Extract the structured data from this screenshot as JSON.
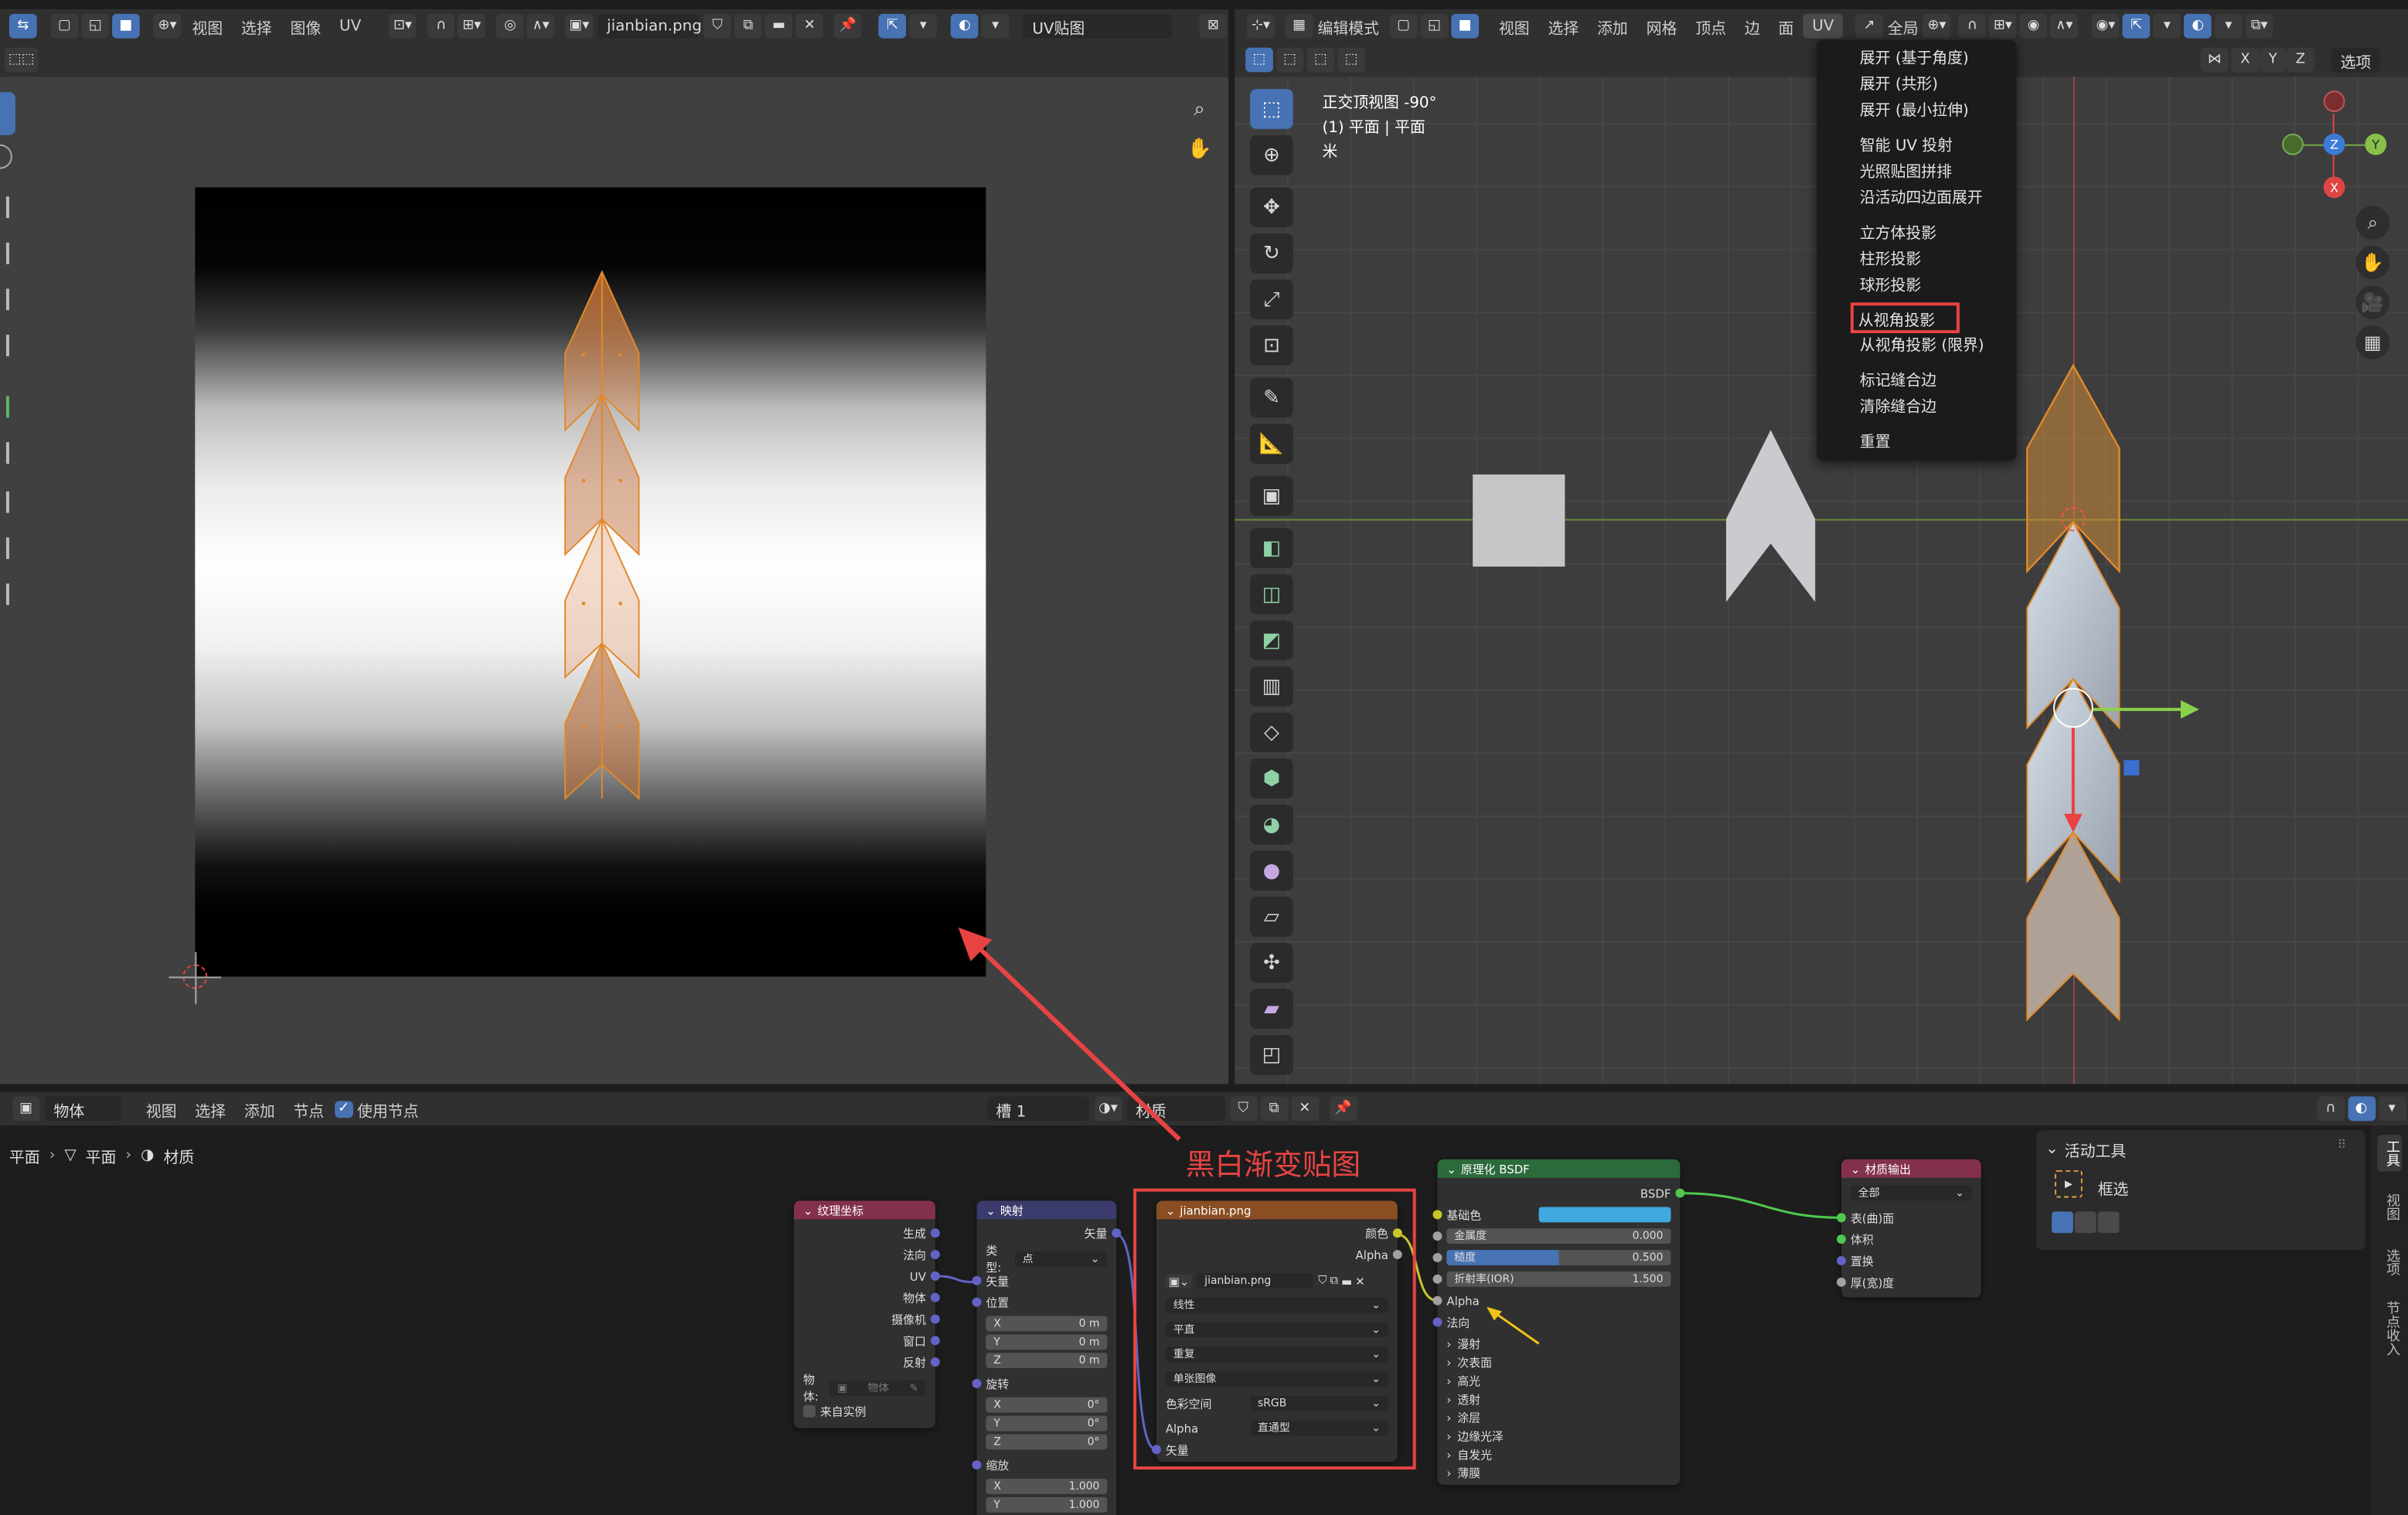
{
  "uv_editor": {
    "header": {
      "menus": [
        "视图",
        "选择",
        "图像",
        "UV"
      ],
      "image_name": "jianbian.png",
      "uv_map": "UV贴图"
    }
  },
  "viewport3d": {
    "header": {
      "mode": "编辑模式",
      "menus": [
        "视图",
        "选择",
        "添加",
        "网格",
        "顶点",
        "边",
        "面",
        "UV"
      ],
      "transform_orientation": "全局"
    },
    "overlay_info": [
      "正交顶视图 -90°",
      "(1) 平面 | 平面",
      "米"
    ],
    "axes_labels": {
      "x": "X",
      "y": "Y",
      "z": "Z"
    },
    "options_label": "选项",
    "xyz_toggles": [
      "X",
      "Y",
      "Z"
    ]
  },
  "uv_menu": {
    "groups": [
      [
        "展开 (基于角度)",
        "展开 (共形)",
        "展开 (最小拉伸)"
      ],
      [
        "智能 UV 投射",
        "光照贴图拼排",
        "沿活动四边面展开"
      ],
      [
        "立方体投影",
        "柱形投影",
        "球形投影"
      ],
      [
        "从视角投影",
        "从视角投影 (限界)"
      ],
      [
        "标记缝合边",
        "清除缝合边"
      ],
      [
        "重置"
      ]
    ],
    "highlighted": "从视角投影"
  },
  "node_editor": {
    "header": {
      "type": "物体",
      "menus": [
        "视图",
        "选择",
        "添加",
        "节点"
      ],
      "use_nodes": "使用节点",
      "slot": "槽 1",
      "material": "材质"
    },
    "breadcrumb": [
      "平面",
      "平面",
      "材质"
    ],
    "annotation": "黑白渐变贴图",
    "nodes": {
      "texcoord": {
        "title": "纹理坐标",
        "outputs": [
          "生成",
          "法向",
          "UV",
          "物体",
          "摄像机",
          "窗口",
          "反射"
        ],
        "object_label": "物体:",
        "object_placeholder": "物体",
        "from_instancer": "来自实例"
      },
      "mapping": {
        "title": "映射",
        "output": "矢量",
        "type_label": "类型:",
        "type_value": "点",
        "vector_in": "矢量",
        "location": "位置",
        "loc": [
          [
            "X",
            "0 m"
          ],
          [
            "Y",
            "0 m"
          ],
          [
            "Z",
            "0 m"
          ]
        ],
        "rotation": "旋转",
        "rot": [
          [
            "X",
            "0°"
          ],
          [
            "Y",
            "0°"
          ],
          [
            "Z",
            "0°"
          ]
        ],
        "scale": "缩放",
        "scl": [
          [
            "X",
            "1.000"
          ],
          [
            "Y",
            "1.000"
          ]
        ]
      },
      "image": {
        "title": "jianbian.png",
        "out_color": "颜色",
        "out_alpha": "Alpha",
        "image_name": "jianbian.png",
        "interpolation": "线性",
        "projection": "平直",
        "extension": "重复",
        "source": "单张图像",
        "color_space_label": "色彩空间",
        "color_space": "sRGB",
        "alpha_label": "Alpha",
        "alpha_mode": "直通型",
        "vector_in": "矢量"
      },
      "bsdf": {
        "title": "原理化 BSDF",
        "output": "BSDF",
        "base_color": "基础色",
        "metallic": {
          "label": "金属度",
          "value": "0.000"
        },
        "roughness": {
          "label": "糙度",
          "value": "0.500"
        },
        "ior": {
          "label": "折射率(IOR)",
          "value": "1.500"
        },
        "alpha": "Alpha",
        "normal": "法向",
        "panels": [
          "漫射",
          "次表面",
          "高光",
          "透射",
          "涂层",
          "边缘光泽",
          "自发光",
          "薄膜"
        ]
      },
      "output": {
        "title": "材质输出",
        "target": "全部",
        "inputs": [
          "表(曲)面",
          "体积",
          "置换",
          "厚(宽)度"
        ]
      }
    },
    "side_panel": {
      "title": "活动工具",
      "tool": "框选",
      "tabs": [
        "工具",
        "视图",
        "选项",
        "节点收入"
      ]
    }
  },
  "colors": {
    "selected_orange": "#e08a2c",
    "highlight_red": "#e84343",
    "accent_blue": "#4772b3"
  }
}
